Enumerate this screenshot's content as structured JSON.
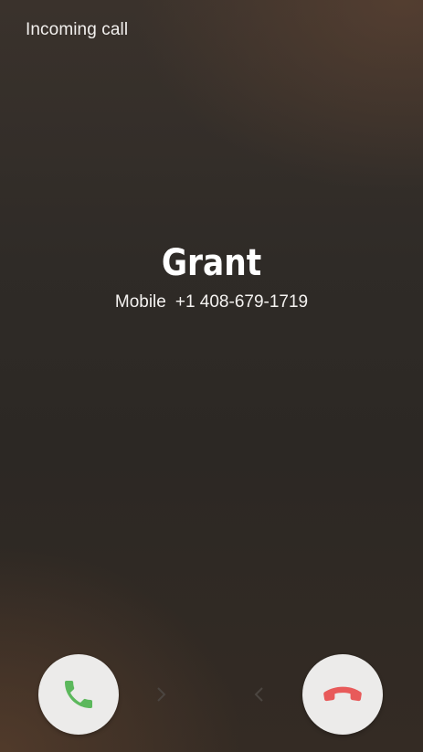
{
  "screen": {
    "status_label": "Incoming call"
  },
  "caller": {
    "name": "Grant",
    "number_type": "Mobile",
    "number": "+1 408-679-1719"
  },
  "actions": {
    "accept": {
      "icon": "phone-icon",
      "color": "#5cb85c"
    },
    "decline": {
      "icon": "hang-up-icon",
      "color": "#e85a5a"
    },
    "swipe_hint_right": "chevron-right-icon",
    "swipe_hint_left": "chevron-left-icon"
  },
  "colors": {
    "button_bg": "#ecebea",
    "background": "#2f2b27"
  }
}
